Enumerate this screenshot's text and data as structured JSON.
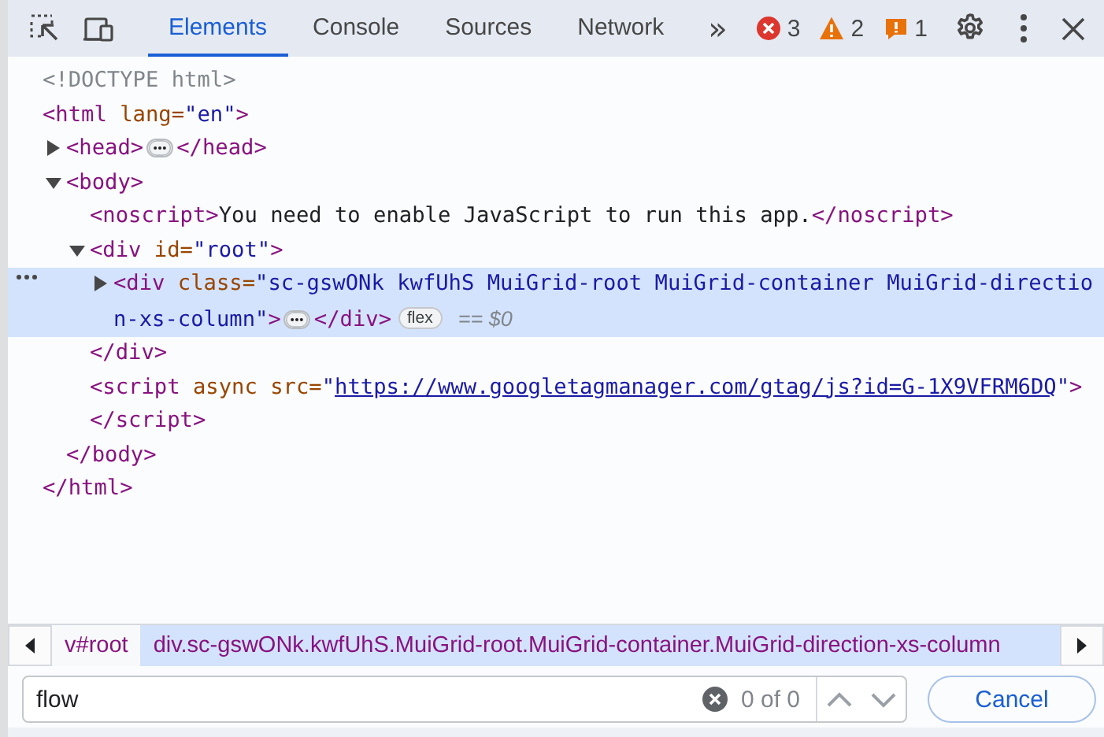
{
  "toolbar": {
    "tabs": [
      {
        "label": "Elements",
        "selected": true
      },
      {
        "label": "Console",
        "selected": false
      },
      {
        "label": "Sources",
        "selected": false
      },
      {
        "label": "Network",
        "selected": false
      }
    ],
    "overflow": "»",
    "counters": [
      {
        "kind": "error",
        "count": "3"
      },
      {
        "kind": "warning",
        "count": "2"
      },
      {
        "kind": "issue",
        "count": "1"
      }
    ]
  },
  "tree": [
    {
      "selected": false,
      "lines": [
        [
          {
            "kind": "doctype",
            "text": "<!DOCTYPE html>"
          }
        ]
      ]
    },
    {
      "selected": false,
      "lines": [
        [
          {
            "kind": "tag",
            "text": "<html"
          },
          {
            "kind": "attr",
            "text": " lang="
          },
          {
            "kind": "val",
            "text": "\"en\""
          },
          {
            "kind": "tag",
            "text": ">"
          }
        ]
      ],
      "close": [
        {
          "kind": "tag",
          "text": "</html>"
        }
      ],
      "children": [
        {
          "selected": false,
          "expanded": false,
          "lines": [
            [
              {
                "kind": "tag",
                "text": "<head>"
              },
              {
                "kind": "more"
              },
              {
                "kind": "tag",
                "text": "</head>"
              }
            ]
          ]
        },
        {
          "selected": false,
          "expanded": true,
          "lines": [
            [
              {
                "kind": "tag",
                "text": "<body>"
              }
            ]
          ],
          "close": [
            {
              "kind": "tag",
              "text": "</body>"
            }
          ],
          "children": [
            {
              "selected": false,
              "lines": [
                [
                  {
                    "kind": "tag",
                    "text": "<noscript>"
                  },
                  {
                    "kind": "plain",
                    "text": "You need to enable JavaScript to run this app."
                  },
                  {
                    "kind": "tag",
                    "text": "</noscript>"
                  }
                ]
              ]
            },
            {
              "selected": false,
              "expanded": true,
              "lines": [
                [
                  {
                    "kind": "tag",
                    "text": "<div"
                  },
                  {
                    "kind": "attr",
                    "text": " id="
                  },
                  {
                    "kind": "val",
                    "text": "\"root\""
                  },
                  {
                    "kind": "tag",
                    "text": ">"
                  }
                ]
              ],
              "close": [
                {
                  "kind": "tag",
                  "text": "</div>"
                }
              ],
              "children": [
                {
                  "selected": true,
                  "expanded": false,
                  "lines": [
                    [
                      {
                        "kind": "tag",
                        "text": "<div"
                      },
                      {
                        "kind": "attr",
                        "text": " class="
                      },
                      {
                        "kind": "val",
                        "text": "\"sc-gswONk kwfUhS MuiGrid-root MuiGrid-container MuiGrid-directio"
                      }
                    ],
                    [
                      {
                        "kind": "val",
                        "text": "n-xs-column\""
                      },
                      {
                        "kind": "tag",
                        "text": ">"
                      },
                      {
                        "kind": "more"
                      },
                      {
                        "kind": "tag",
                        "text": "</div>"
                      },
                      {
                        "kind": "badge",
                        "text": "flex"
                      },
                      {
                        "kind": "ref",
                        "text": "== $0"
                      }
                    ]
                  ]
                }
              ]
            },
            {
              "selected": false,
              "lines": [
                [
                  {
                    "kind": "tag",
                    "text": "<script"
                  },
                  {
                    "kind": "attr",
                    "text": " async src="
                  },
                  {
                    "kind": "val",
                    "text": "\""
                  },
                  {
                    "kind": "link",
                    "text": "https://www.googletagmanager.com/gtag/js?id=G-1X9VFRM6DQ"
                  },
                  {
                    "kind": "val",
                    "text": "\""
                  },
                  {
                    "kind": "tag",
                    "text": ">"
                  }
                ]
              ]
            },
            {
              "selected": false,
              "lines": [
                [
                  {
                    "kind": "tag",
                    "text": "</script>"
                  }
                ]
              ]
            }
          ]
        }
      ]
    }
  ],
  "breadcrumbs": [
    {
      "label": "v#root",
      "selected": false
    },
    {
      "label": "div.sc-gswONk.kwfUhS.MuiGrid-root.MuiGrid-container.MuiGrid-direction-xs-column",
      "selected": true
    }
  ],
  "search": {
    "value": "flow",
    "count": "0 of 0",
    "cancel": "Cancel"
  }
}
